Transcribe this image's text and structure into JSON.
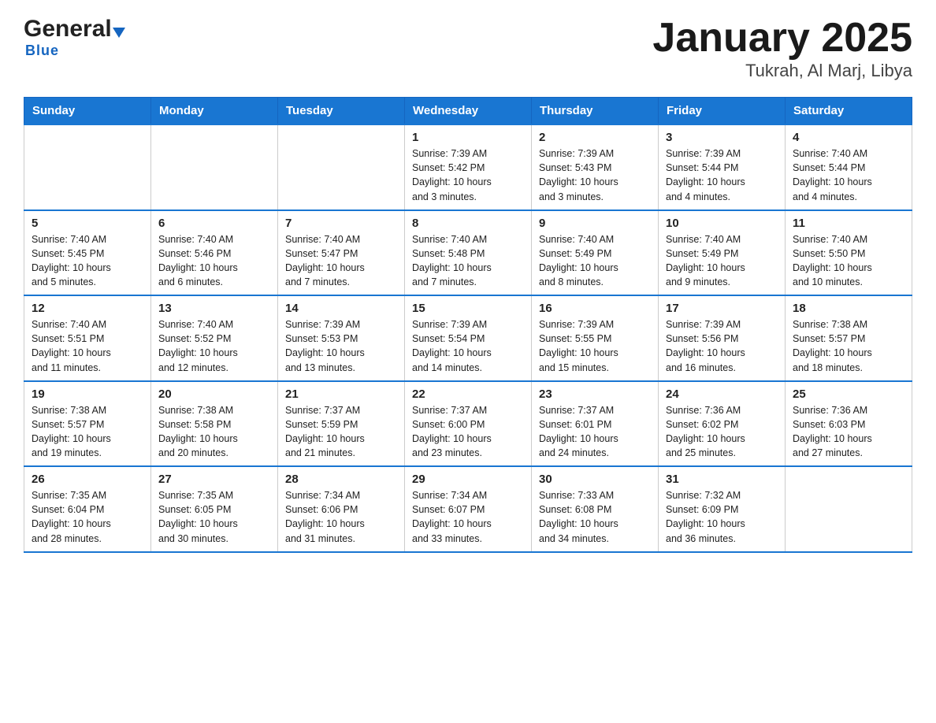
{
  "header": {
    "logo_general": "General",
    "logo_blue": "Blue",
    "month_title": "January 2025",
    "location": "Tukrah, Al Marj, Libya"
  },
  "days_of_week": [
    "Sunday",
    "Monday",
    "Tuesday",
    "Wednesday",
    "Thursday",
    "Friday",
    "Saturday"
  ],
  "weeks": [
    [
      {
        "day": "",
        "info": ""
      },
      {
        "day": "",
        "info": ""
      },
      {
        "day": "",
        "info": ""
      },
      {
        "day": "1",
        "info": "Sunrise: 7:39 AM\nSunset: 5:42 PM\nDaylight: 10 hours\nand 3 minutes."
      },
      {
        "day": "2",
        "info": "Sunrise: 7:39 AM\nSunset: 5:43 PM\nDaylight: 10 hours\nand 3 minutes."
      },
      {
        "day": "3",
        "info": "Sunrise: 7:39 AM\nSunset: 5:44 PM\nDaylight: 10 hours\nand 4 minutes."
      },
      {
        "day": "4",
        "info": "Sunrise: 7:40 AM\nSunset: 5:44 PM\nDaylight: 10 hours\nand 4 minutes."
      }
    ],
    [
      {
        "day": "5",
        "info": "Sunrise: 7:40 AM\nSunset: 5:45 PM\nDaylight: 10 hours\nand 5 minutes."
      },
      {
        "day": "6",
        "info": "Sunrise: 7:40 AM\nSunset: 5:46 PM\nDaylight: 10 hours\nand 6 minutes."
      },
      {
        "day": "7",
        "info": "Sunrise: 7:40 AM\nSunset: 5:47 PM\nDaylight: 10 hours\nand 7 minutes."
      },
      {
        "day": "8",
        "info": "Sunrise: 7:40 AM\nSunset: 5:48 PM\nDaylight: 10 hours\nand 7 minutes."
      },
      {
        "day": "9",
        "info": "Sunrise: 7:40 AM\nSunset: 5:49 PM\nDaylight: 10 hours\nand 8 minutes."
      },
      {
        "day": "10",
        "info": "Sunrise: 7:40 AM\nSunset: 5:49 PM\nDaylight: 10 hours\nand 9 minutes."
      },
      {
        "day": "11",
        "info": "Sunrise: 7:40 AM\nSunset: 5:50 PM\nDaylight: 10 hours\nand 10 minutes."
      }
    ],
    [
      {
        "day": "12",
        "info": "Sunrise: 7:40 AM\nSunset: 5:51 PM\nDaylight: 10 hours\nand 11 minutes."
      },
      {
        "day": "13",
        "info": "Sunrise: 7:40 AM\nSunset: 5:52 PM\nDaylight: 10 hours\nand 12 minutes."
      },
      {
        "day": "14",
        "info": "Sunrise: 7:39 AM\nSunset: 5:53 PM\nDaylight: 10 hours\nand 13 minutes."
      },
      {
        "day": "15",
        "info": "Sunrise: 7:39 AM\nSunset: 5:54 PM\nDaylight: 10 hours\nand 14 minutes."
      },
      {
        "day": "16",
        "info": "Sunrise: 7:39 AM\nSunset: 5:55 PM\nDaylight: 10 hours\nand 15 minutes."
      },
      {
        "day": "17",
        "info": "Sunrise: 7:39 AM\nSunset: 5:56 PM\nDaylight: 10 hours\nand 16 minutes."
      },
      {
        "day": "18",
        "info": "Sunrise: 7:38 AM\nSunset: 5:57 PM\nDaylight: 10 hours\nand 18 minutes."
      }
    ],
    [
      {
        "day": "19",
        "info": "Sunrise: 7:38 AM\nSunset: 5:57 PM\nDaylight: 10 hours\nand 19 minutes."
      },
      {
        "day": "20",
        "info": "Sunrise: 7:38 AM\nSunset: 5:58 PM\nDaylight: 10 hours\nand 20 minutes."
      },
      {
        "day": "21",
        "info": "Sunrise: 7:37 AM\nSunset: 5:59 PM\nDaylight: 10 hours\nand 21 minutes."
      },
      {
        "day": "22",
        "info": "Sunrise: 7:37 AM\nSunset: 6:00 PM\nDaylight: 10 hours\nand 23 minutes."
      },
      {
        "day": "23",
        "info": "Sunrise: 7:37 AM\nSunset: 6:01 PM\nDaylight: 10 hours\nand 24 minutes."
      },
      {
        "day": "24",
        "info": "Sunrise: 7:36 AM\nSunset: 6:02 PM\nDaylight: 10 hours\nand 25 minutes."
      },
      {
        "day": "25",
        "info": "Sunrise: 7:36 AM\nSunset: 6:03 PM\nDaylight: 10 hours\nand 27 minutes."
      }
    ],
    [
      {
        "day": "26",
        "info": "Sunrise: 7:35 AM\nSunset: 6:04 PM\nDaylight: 10 hours\nand 28 minutes."
      },
      {
        "day": "27",
        "info": "Sunrise: 7:35 AM\nSunset: 6:05 PM\nDaylight: 10 hours\nand 30 minutes."
      },
      {
        "day": "28",
        "info": "Sunrise: 7:34 AM\nSunset: 6:06 PM\nDaylight: 10 hours\nand 31 minutes."
      },
      {
        "day": "29",
        "info": "Sunrise: 7:34 AM\nSunset: 6:07 PM\nDaylight: 10 hours\nand 33 minutes."
      },
      {
        "day": "30",
        "info": "Sunrise: 7:33 AM\nSunset: 6:08 PM\nDaylight: 10 hours\nand 34 minutes."
      },
      {
        "day": "31",
        "info": "Sunrise: 7:32 AM\nSunset: 6:09 PM\nDaylight: 10 hours\nand 36 minutes."
      },
      {
        "day": "",
        "info": ""
      }
    ]
  ],
  "colors": {
    "header_bg": "#1976d2",
    "header_text": "#ffffff",
    "border": "#aaaaaa",
    "accent": "#1565c0"
  }
}
